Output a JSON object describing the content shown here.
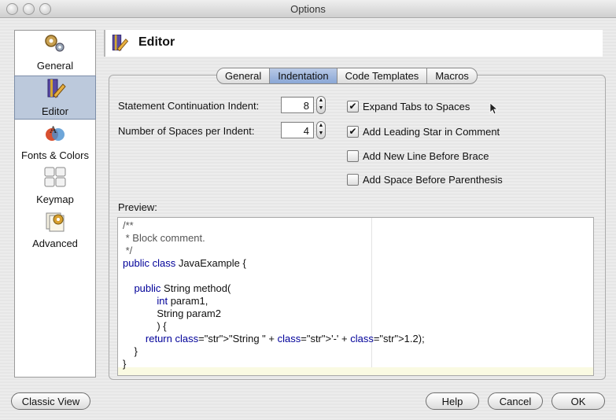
{
  "window": {
    "title": "Options"
  },
  "sidebar": {
    "items": [
      {
        "label": "General",
        "icon": "gears-icon"
      },
      {
        "label": "Editor",
        "icon": "editor-pen-icon",
        "selected": true
      },
      {
        "label": "Fonts & Colors",
        "icon": "fonts-colors-icon"
      },
      {
        "label": "Keymap",
        "icon": "keymap-keys-icon"
      },
      {
        "label": "Advanced",
        "icon": "advanced-gear-icon"
      }
    ]
  },
  "header": {
    "title": "Editor"
  },
  "tabs": [
    {
      "label": "General"
    },
    {
      "label": "Indentation",
      "selected": true
    },
    {
      "label": "Code Templates"
    },
    {
      "label": "Macros"
    }
  ],
  "fields": {
    "continuation_label": "Statement Continuation Indent:",
    "continuation_value": "8",
    "spaces_label": "Number of Spaces per Indent:",
    "spaces_value": "4"
  },
  "checkboxes": [
    {
      "label": "Expand Tabs to Spaces",
      "checked": true
    },
    {
      "label": "Add Leading Star in Comment",
      "checked": true
    },
    {
      "label": "Add New Line Before Brace",
      "checked": false
    },
    {
      "label": "Add Space Before Parenthesis",
      "checked": false
    }
  ],
  "preview": {
    "label": "Preview:",
    "lines": [
      "/**",
      " * Block comment.",
      " */",
      "public class JavaExample {",
      "",
      "    public String method(",
      "            int param1,",
      "            String param2",
      "            ) {",
      "        return \"String \" + '-' + 1.2);",
      "    }",
      "}"
    ]
  },
  "buttons": {
    "classic_view": "Classic View",
    "help": "Help",
    "cancel": "Cancel",
    "ok": "OK"
  }
}
